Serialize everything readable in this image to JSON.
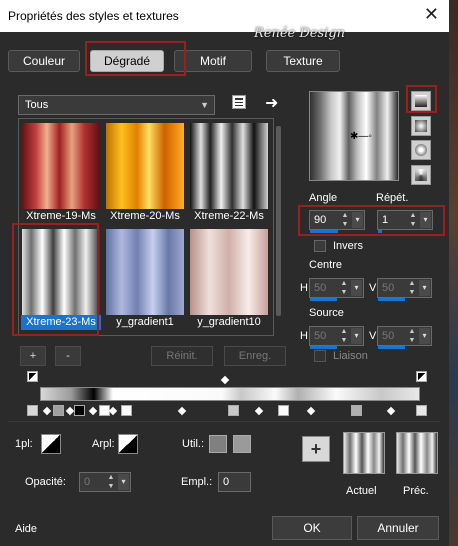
{
  "window": {
    "title": "Propriétés des styles et textures",
    "close_glyph": "✕"
  },
  "watermark": "Renée Design",
  "tabs": [
    {
      "label": "Couleur"
    },
    {
      "label": "Dégradé",
      "selected": true
    },
    {
      "label": "Motif"
    },
    {
      "label": "Texture"
    }
  ],
  "category_dropdown": {
    "value": "Tous"
  },
  "gallery": {
    "items": [
      {
        "label": "Xtreme-19-Ms"
      },
      {
        "label": "Xtreme-20-Ms"
      },
      {
        "label": "Xtreme-22-Ms"
      },
      {
        "label": "Xtreme-23-Ms",
        "selected": true
      },
      {
        "label": "y_gradient1"
      },
      {
        "label": "y_gradient10"
      }
    ]
  },
  "gallery_buttons": {
    "add": "+",
    "remove": "-",
    "reset": "Réinit.",
    "save": "Enreg."
  },
  "angle": {
    "label": "Angle",
    "value": "90"
  },
  "repeat": {
    "label": "Répét.",
    "value": "1"
  },
  "invert": {
    "label": "Invers",
    "checked": false
  },
  "center": {
    "label": "Centre",
    "h_label": "H",
    "h_value": "50",
    "v_label": "V",
    "v_value": "50"
  },
  "source": {
    "label": "Source",
    "h_label": "H",
    "h_value": "50",
    "v_label": "V",
    "v_value": "50"
  },
  "link": {
    "label": "Liaison",
    "checked": false
  },
  "stop_controls": {
    "first_label": "1pl:",
    "background_label": "Arpl:",
    "user_label": "Util.:",
    "opacity_label": "Opacité:",
    "opacity_value": "0",
    "location_label": "Empl.:",
    "location_value": "0"
  },
  "add_stop_button": "+",
  "previews": {
    "current_label": "Actuel",
    "previous_label": "Préc."
  },
  "footer": {
    "help": "Aide",
    "ok": "OK",
    "cancel": "Annuler"
  },
  "colors": {
    "accent": "#1874cd",
    "highlight_box": "#9a1f1f",
    "background": "#2b2b2b"
  }
}
